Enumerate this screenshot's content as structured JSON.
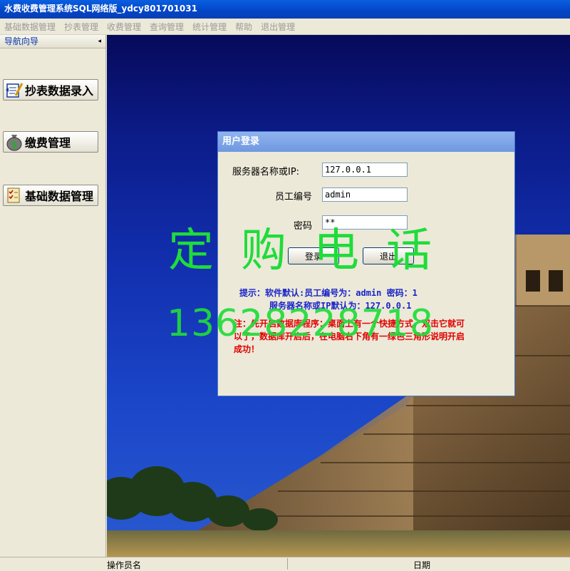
{
  "window": {
    "title": "水费收费管理系统SQL网络版_ydcy801701031"
  },
  "menu": {
    "items": [
      "基础数据管理",
      "抄表管理",
      "收费管理",
      "查询管理",
      "统计管理",
      "帮助",
      "退出管理"
    ]
  },
  "nav": {
    "header": "导航向导",
    "collapse_glyph": "◂",
    "buttons": [
      {
        "label": "抄表数据录入",
        "icon": "meter-entry-icon"
      },
      {
        "label": "缴费管理",
        "icon": "money-bag-icon"
      },
      {
        "label": "基础数据管理",
        "icon": "checklist-icon"
      }
    ]
  },
  "login": {
    "title": "用户登录",
    "server_label": "服务器名称或IP:",
    "server_value": "127.0.0.1",
    "user_label": "员工编号",
    "user_value": "admin",
    "password_label": "密码",
    "password_value": "**",
    "login_button": "登录",
    "exit_button": "退出",
    "hint_line1": "提示：软件默认:员工编号为：admin 密码：1",
    "hint_line2": "服务器名称或IP默认为：127.0.0.1",
    "note": "注：先开启数据库程序：桌面上有一个快捷方式，双击它就可以了，数据库开启后，在电脑右下角有一绿色三角形说明开启成功！"
  },
  "watermark": {
    "title": "定购电话",
    "phone": "13628228718"
  },
  "status": {
    "operator_label": "操作员名",
    "date_label": "日期"
  },
  "colors": {
    "titlebar": "#0245c8",
    "hint_blue": "#1a25c8",
    "note_red": "#e00000",
    "watermark_green": "#1fdc3a"
  }
}
